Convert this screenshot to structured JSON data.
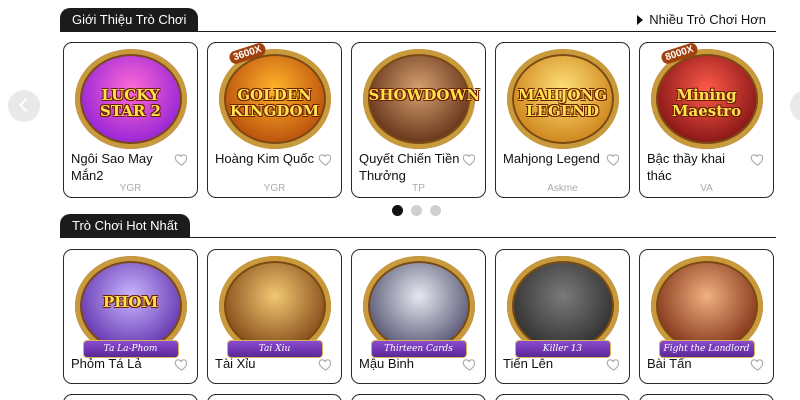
{
  "intro_section": {
    "title": "Giới Thiệu Trò Chơi",
    "more_link": "Nhiều Trò Chơi Hơn",
    "games": [
      {
        "title": "Ngôi Sao May Mắn2",
        "provider": "YGR",
        "art": "LUCKY STAR 2",
        "colors": [
          "#ff6ad5",
          "#8b1dd6"
        ]
      },
      {
        "title": "Hoàng Kim Quốc",
        "provider": "YGR",
        "art": "GOLDEN KINGDOM",
        "badge": "3600X",
        "colors": [
          "#ffb42a",
          "#b3460a"
        ]
      },
      {
        "title": "Quyết Chiến Tiền Thưởng",
        "provider": "TP",
        "art": "SHOWDOWN",
        "colors": [
          "#d6a070",
          "#5a2a12"
        ]
      },
      {
        "title": "Mahjong Legend",
        "provider": "Askme",
        "art": "MAHJONG LEGEND",
        "colors": [
          "#ffe07a",
          "#c97c12"
        ]
      },
      {
        "title": "Bậc thầy khai thác",
        "provider": "VA",
        "art": "Mining Maestro",
        "badge": "8000X",
        "colors": [
          "#ff5a4a",
          "#7a0f10"
        ]
      }
    ],
    "pagination": {
      "pages": 3,
      "active": 1
    }
  },
  "hot_section": {
    "title": "Trò Chơi Hot Nhất",
    "games": [
      {
        "title": "Phỏm Tá Lả",
        "art": "PHOM",
        "plaque": "Ta La-Phom",
        "colors": [
          "#c9b6ff",
          "#5b2aa8"
        ]
      },
      {
        "title": "Tài Xỉu",
        "art": "",
        "plaque": "Tai Xiu",
        "colors": [
          "#f2c872",
          "#7a3f10"
        ]
      },
      {
        "title": "Mậu Binh",
        "art": "",
        "plaque": "Thirteen Cards",
        "colors": [
          "#e8e8f0",
          "#4a4a6a"
        ]
      },
      {
        "title": "Tiến Lên",
        "art": "",
        "plaque": "Killer 13",
        "colors": [
          "#7a7a7a",
          "#2a2a2a"
        ]
      },
      {
        "title": "Bài Tấn",
        "art": "",
        "plaque": "Fight the Landlord",
        "colors": [
          "#f0b080",
          "#7a2a10"
        ]
      }
    ]
  },
  "icons": {
    "heart": "heart-icon",
    "prev": "chevron-left-icon",
    "next": "chevron-right-icon",
    "more": "triangle-right-icon"
  }
}
